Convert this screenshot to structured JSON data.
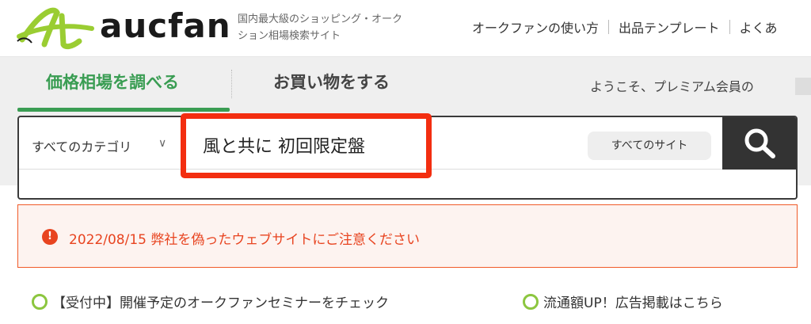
{
  "header": {
    "logo_text": "aucfan",
    "tagline": "国内最大級のショッピング・オークション相場検索サイト",
    "util_nav": [
      "オークファンの使い方",
      "出品テンプレート",
      "よくあ"
    ]
  },
  "tabs": {
    "price": "価格相場を調べる",
    "shop": "お買い物をする",
    "welcome": "ようこそ、プレミアム会員の"
  },
  "search": {
    "category": "すべてのカテゴリ",
    "query": "風と共に 初回限定盤",
    "site_button": "すべてのサイト"
  },
  "notice": {
    "icon_text": "!",
    "text": "2022/08/15 弊社を偽ったウェブサイトにご注意ください"
  },
  "links": {
    "seminar": "【受付中】開催予定のオークファンセミナーをチェック",
    "ads": "流通額UP！広告掲載はこちら"
  },
  "colors": {
    "accent_green": "#3a9d53",
    "logo_green": "#9acd32",
    "alert_red": "#e84420",
    "highlight_red": "#f32e10",
    "search_dark": "#333333"
  }
}
